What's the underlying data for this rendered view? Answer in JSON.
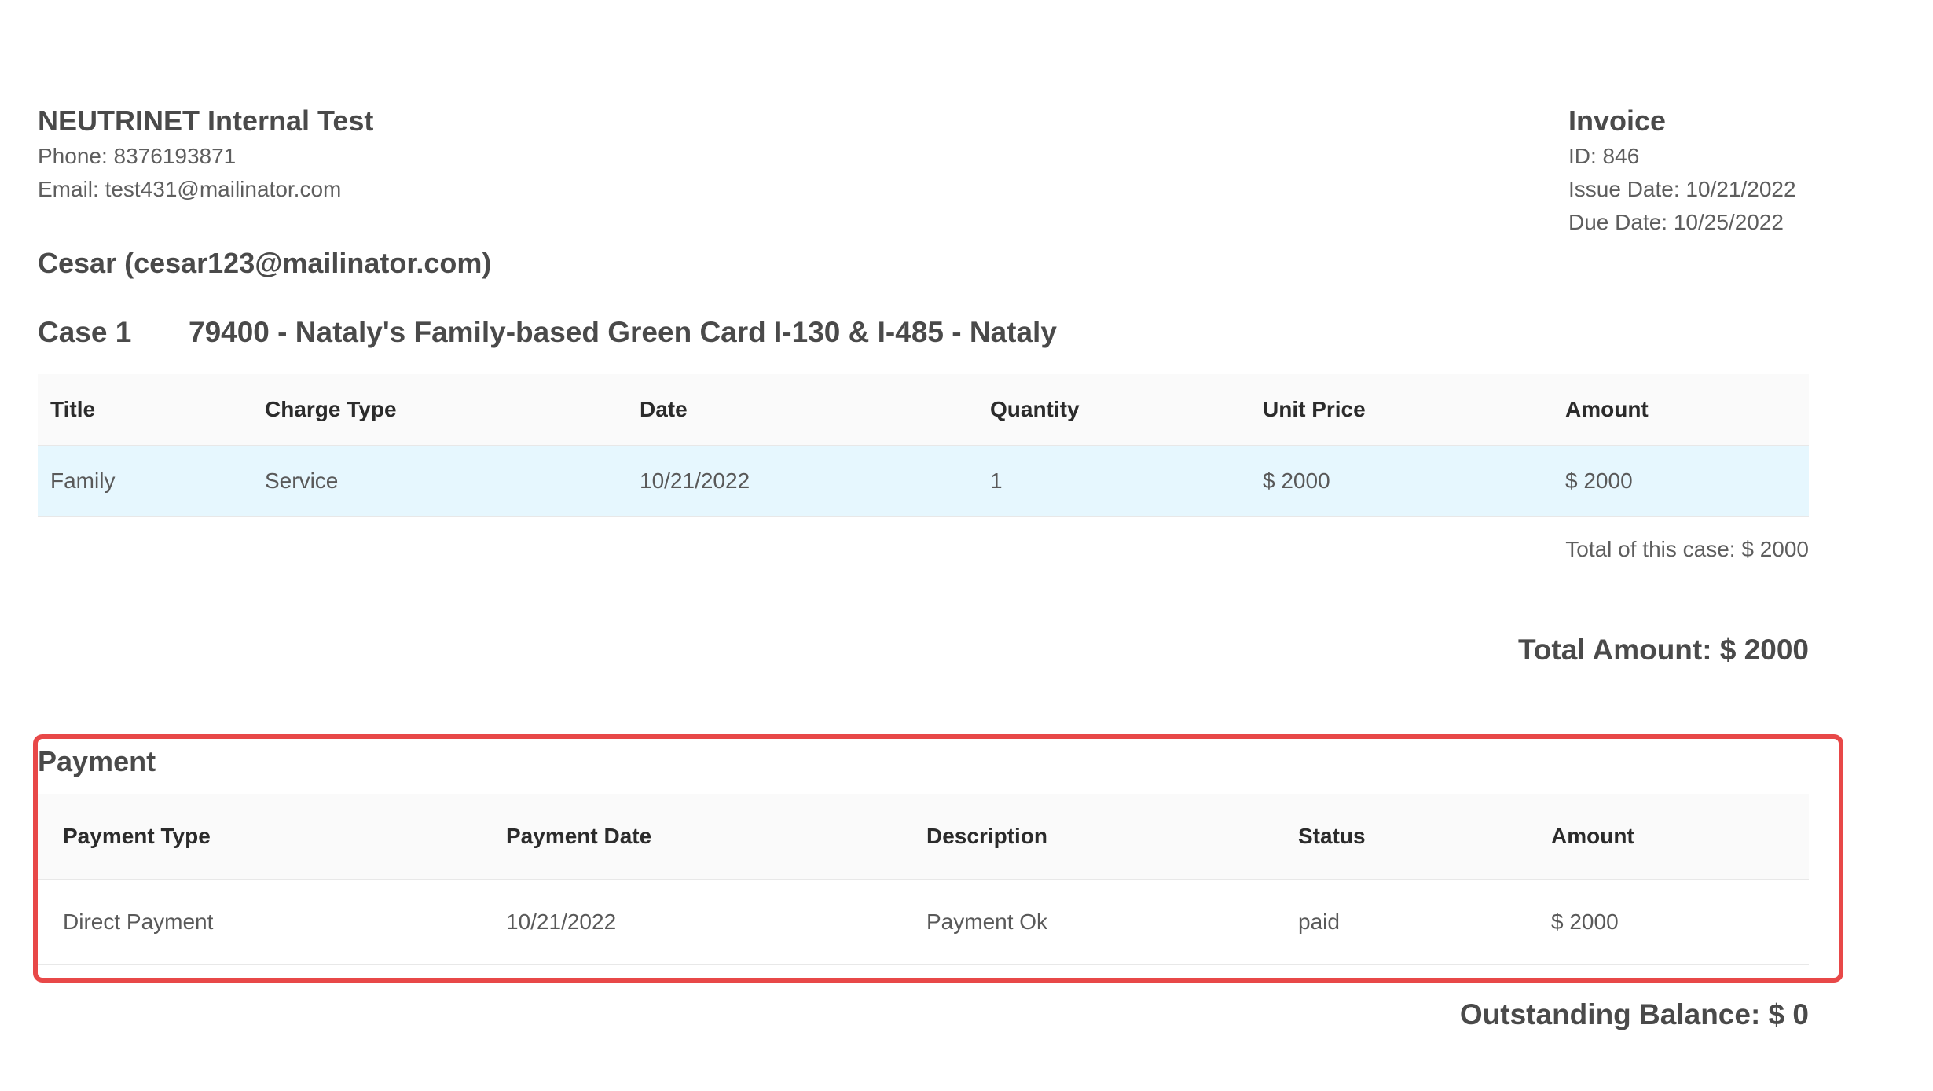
{
  "company": {
    "name": "NEUTRINET Internal Test",
    "phone": "Phone: 8376193871",
    "email": "Email: test431@mailinator.com"
  },
  "invoice": {
    "heading": "Invoice",
    "id": "ID: 846",
    "issue_date": "Issue Date: 10/21/2022",
    "due_date": "Due Date: 10/25/2022"
  },
  "client": "Cesar (cesar123@mailinator.com)",
  "case": {
    "label": "Case 1",
    "title": "79400 - Nataly's Family-based Green Card I-130 & I-485 - Nataly",
    "columns": [
      "Title",
      "Charge Type",
      "Date",
      "Quantity",
      "Unit Price",
      "Amount"
    ],
    "rows": [
      [
        "Family",
        "Service",
        "10/21/2022",
        "1",
        "$ 2000",
        "$ 2000"
      ]
    ],
    "total": "Total of this case: $ 2000"
  },
  "total_amount": "Total Amount: $ 2000",
  "payment": {
    "title": "Payment",
    "columns": [
      "Payment Type",
      "Payment Date",
      "Description",
      "Status",
      "Amount"
    ],
    "rows": [
      [
        "Direct Payment",
        "10/21/2022",
        "Payment Ok",
        "paid",
        "$ 2000"
      ]
    ]
  },
  "outstanding_balance": "Outstanding Balance: $ 0",
  "colors": {
    "highlight_row": "#e6f7fe",
    "annotation_border": "#e84848"
  }
}
